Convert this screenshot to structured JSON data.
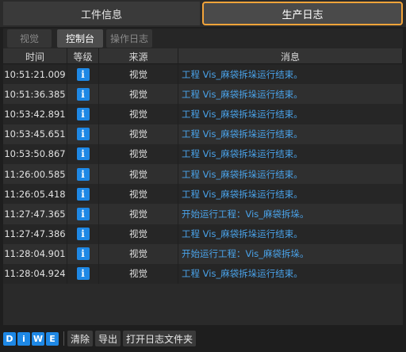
{
  "top_tabs": [
    {
      "label": "工件信息"
    },
    {
      "label": "生产日志"
    }
  ],
  "sub_tabs": [
    {
      "label": "视觉"
    },
    {
      "label": "控制台"
    },
    {
      "label": "操作日志"
    }
  ],
  "table": {
    "headers": [
      "时间",
      "等级",
      "来源",
      "消息"
    ],
    "rows": [
      {
        "time": "10:51:21.009",
        "level": "i",
        "source": "视觉",
        "message": "工程 Vis_麻袋拆垛运行结束。"
      },
      {
        "time": "10:51:36.385",
        "level": "i",
        "source": "视觉",
        "message": "工程 Vis_麻袋拆垛运行结束。"
      },
      {
        "time": "10:53:42.891",
        "level": "i",
        "source": "视觉",
        "message": "工程 Vis_麻袋拆垛运行结束。"
      },
      {
        "time": "10:53:45.651",
        "level": "i",
        "source": "视觉",
        "message": "工程 Vis_麻袋拆垛运行结束。"
      },
      {
        "time": "10:53:50.867",
        "level": "i",
        "source": "视觉",
        "message": "工程 Vis_麻袋拆垛运行结束。"
      },
      {
        "time": "11:26:00.585",
        "level": "i",
        "source": "视觉",
        "message": "工程 Vis_麻袋拆垛运行结束。"
      },
      {
        "time": "11:26:05.418",
        "level": "i",
        "source": "视觉",
        "message": "工程 Vis_麻袋拆垛运行结束。"
      },
      {
        "time": "11:27:47.365",
        "level": "i",
        "source": "视觉",
        "message": "开始运行工程：Vis_麻袋拆垛。"
      },
      {
        "time": "11:27:47.386",
        "level": "i",
        "source": "视觉",
        "message": "工程 Vis_麻袋拆垛运行结束。"
      },
      {
        "time": "11:28:04.901",
        "level": "i",
        "source": "视觉",
        "message": "开始运行工程：Vis_麻袋拆垛。"
      },
      {
        "time": "11:28:04.924",
        "level": "i",
        "source": "视觉",
        "message": "工程 Vis_麻袋拆垛运行结束。"
      }
    ]
  },
  "bottom": {
    "level_buttons": [
      "D",
      "i",
      "W",
      "E"
    ],
    "clear_label": "清除",
    "export_label": "导出",
    "open_folder_label": "打开日志文件夹"
  },
  "colors": {
    "accent": "#f3a43a",
    "info": "#1e88e5",
    "message_text": "#4aa3ea"
  }
}
